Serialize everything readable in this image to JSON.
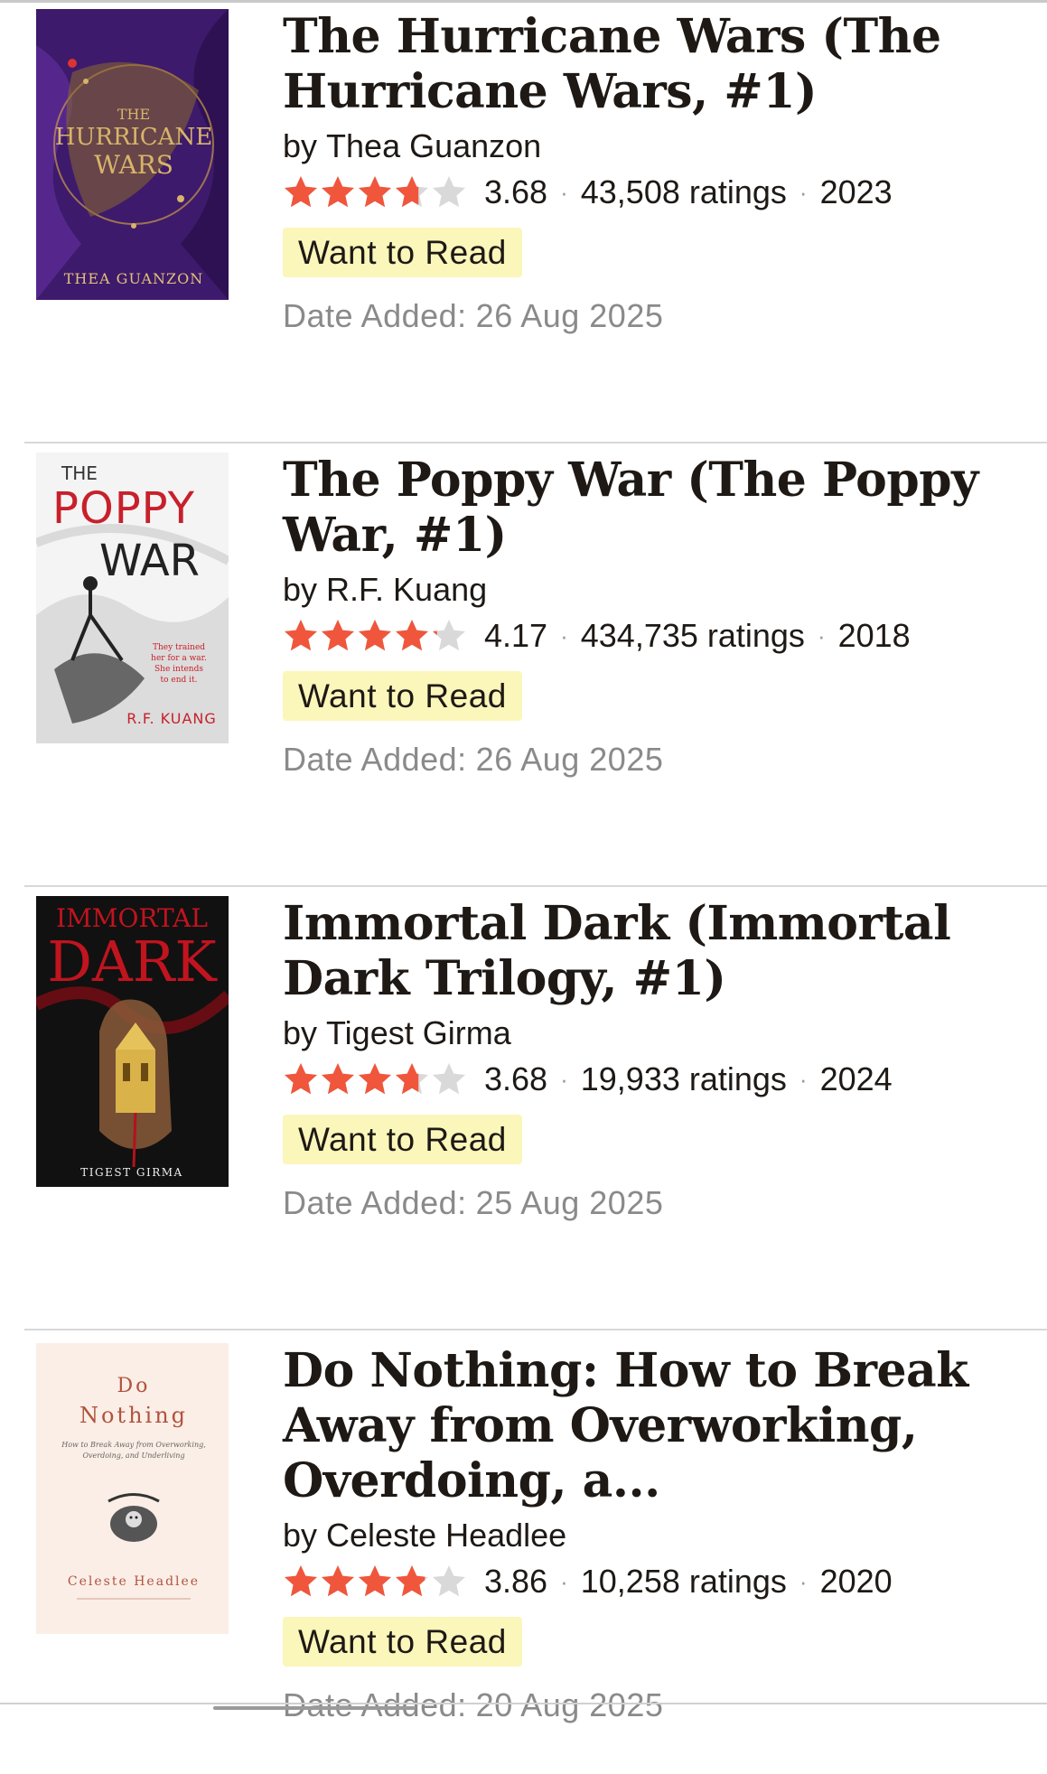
{
  "books": [
    {
      "title": "The Hurricane Wars (The Hurricane Wars, #1)",
      "by": "by",
      "author": "Thea Guanzon",
      "rating": "3.68",
      "rating_value": 3.68,
      "ratings_count": "43,508 ratings",
      "year": "2023",
      "shelf_button": "Want to Read",
      "date_label": "Date Added:",
      "date_added": "26 Aug 2025",
      "cover": {
        "line1": "THE",
        "line2": "HURRICANE",
        "line3": "WARS",
        "author": "THEA GUANZON",
        "bg": "#3d1a6b",
        "accent": "#c99a4a"
      }
    },
    {
      "title": "The Poppy War (The Poppy War, #1)",
      "by": "by",
      "author": "R.F. Kuang",
      "rating": "4.17",
      "rating_value": 4.17,
      "ratings_count": "434,735 ratings",
      "year": "2018",
      "shelf_button": "Want to Read",
      "date_label": "Date Added:",
      "date_added": "26 Aug 2025",
      "cover": {
        "line1": "THE",
        "line2": "POPPY",
        "line3": "WAR",
        "tagline1": "They trained",
        "tagline2": "her for a war.",
        "tagline3": "She intends",
        "tagline4": "to end it.",
        "author": "R.F. KUANG",
        "bg": "#f4f4f4",
        "accent": "#c8202b"
      }
    },
    {
      "title": "Immortal Dark (Immortal Dark Trilogy, #1)",
      "by": "by",
      "author": "Tigest Girma",
      "rating": "3.68",
      "rating_value": 3.68,
      "ratings_count": "19,933 ratings",
      "year": "2024",
      "shelf_button": "Want to Read",
      "date_label": "Date Added:",
      "date_added": "25 Aug 2025",
      "cover": {
        "line1": "IMMORTAL",
        "line2": "DARK",
        "author": "TIGEST GIRMA",
        "bg": "#111111",
        "accent": "#b3121c"
      }
    },
    {
      "title": "Do Nothing: How to Break Away from Overworking, Overdoing, a...",
      "by": "by",
      "author": "Celeste Headlee",
      "rating": "3.86",
      "rating_value": 3.86,
      "ratings_count": "10,258 ratings",
      "year": "2020",
      "shelf_button": "Want to Read",
      "date_label": "Date Added:",
      "date_added": "20 Aug 2025",
      "cover": {
        "line1": "Do",
        "line2": "Nothing",
        "subtitle1": "How to Break Away from Overworking,",
        "subtitle2": "Overdoing, and Underliving",
        "author": "Celeste Headlee",
        "bg": "#fbeee6",
        "accent": "#b0533f"
      }
    }
  ],
  "colors": {
    "star_filled": "#f0563c",
    "star_empty": "#d9d9d9",
    "button_bg": "#fbf6ba",
    "date_text": "#8a8a8a"
  }
}
